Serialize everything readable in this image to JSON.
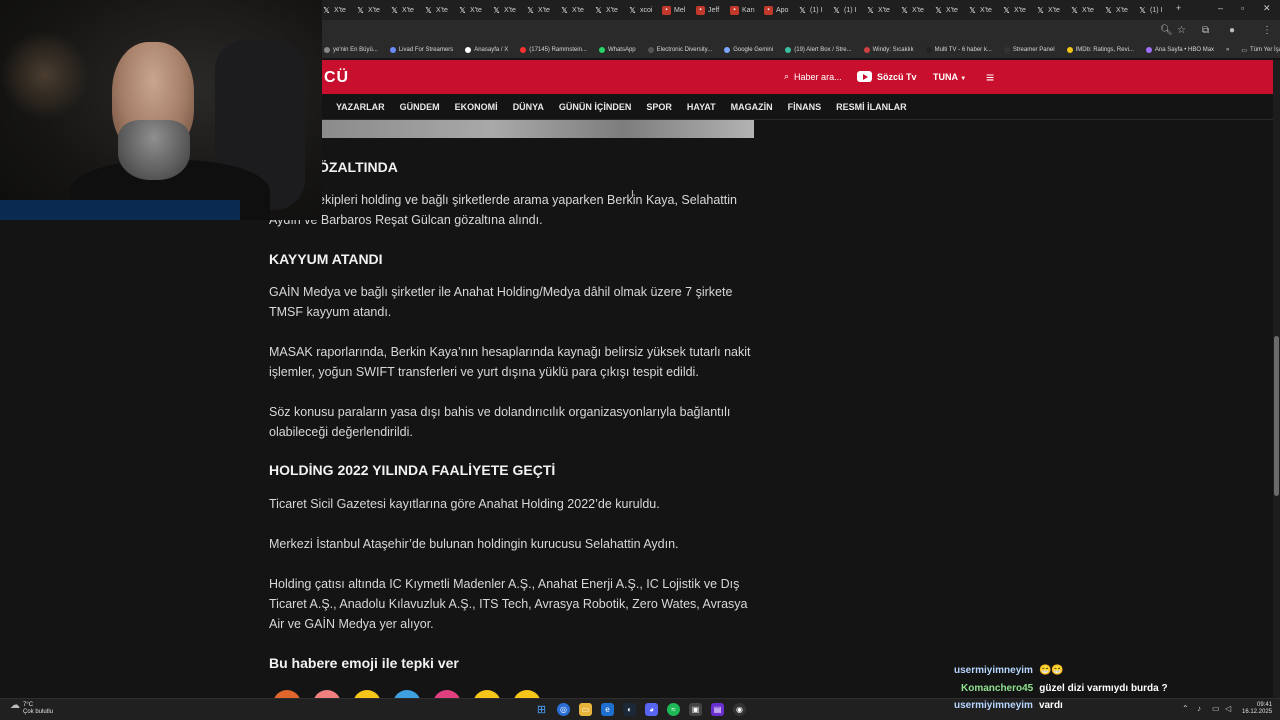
{
  "browser": {
    "tabs": [
      {
        "label": "X'te",
        "icon": "x-icon"
      },
      {
        "label": "X'te",
        "icon": "x-icon"
      },
      {
        "label": "X'te",
        "icon": "x-icon"
      },
      {
        "label": "X'te",
        "icon": "x-icon"
      },
      {
        "label": "X'te",
        "icon": "x-icon"
      },
      {
        "label": "X'te",
        "icon": "x-icon"
      },
      {
        "label": "X'te",
        "icon": "x-icon"
      },
      {
        "label": "X'te",
        "icon": "x-icon"
      },
      {
        "label": "X'te",
        "icon": "x-icon"
      },
      {
        "label": "xcoi",
        "icon": "x-icon"
      },
      {
        "label": "Mel",
        "icon": "red-site-icon"
      },
      {
        "label": "Jeff",
        "icon": "red-site-icon"
      },
      {
        "label": "Karı",
        "icon": "red-site-icon"
      },
      {
        "label": "Apo",
        "icon": "red-site-icon"
      },
      {
        "label": "(1) I",
        "icon": "x-icon"
      },
      {
        "label": "(1) I",
        "icon": "x-icon"
      },
      {
        "label": "X'te",
        "icon": "x-icon"
      },
      {
        "label": "X'te",
        "icon": "x-icon"
      },
      {
        "label": "X'te",
        "icon": "x-icon"
      },
      {
        "label": "X'te",
        "icon": "x-icon"
      },
      {
        "label": "X'te",
        "icon": "x-icon"
      },
      {
        "label": "X'te",
        "icon": "x-icon"
      },
      {
        "label": "X'te",
        "icon": "x-icon"
      },
      {
        "label": "X'te",
        "icon": "x-icon"
      },
      {
        "label": "(1) I",
        "icon": "x-icon"
      }
    ],
    "bookmarks": [
      {
        "label": "ye'nin En Büyü...",
        "color": "#888888"
      },
      {
        "label": "Livad For Streamers",
        "color": "#6b8cff"
      },
      {
        "label": "Anasayfa / X",
        "color": "#ffffff"
      },
      {
        "label": "(17145) Rammstein...",
        "color": "#ff3030"
      },
      {
        "label": "WhatsApp",
        "color": "#25d366"
      },
      {
        "label": "Electronic Diversity...",
        "color": "#555555"
      },
      {
        "label": "Google Gemini",
        "color": "#7aa7ff"
      },
      {
        "label": "(19) Alert Box / Stre...",
        "color": "#39c0a0"
      },
      {
        "label": "Windy: Sıcaklık",
        "color": "#d04040"
      },
      {
        "label": "Multi TV - 6 haber k...",
        "color": "#222222"
      },
      {
        "label": "Streamer Panel",
        "color": "#333333"
      },
      {
        "label": "IMDb: Ratings, Revi...",
        "color": "#f5c518"
      },
      {
        "label": "Ana Sayfa • HBO Max",
        "color": "#a070ff"
      }
    ],
    "bookmarks_more": "»",
    "all_bookmarks": "Tüm Yer İşaretleri"
  },
  "site": {
    "logo": "CÜ",
    "search_placeholder": "Haber ara...",
    "tv_label": "Sözcü Tv",
    "user_label": "TUNA",
    "nav": [
      "YAZARLAR",
      "GÜNDEM",
      "EKONOMİ",
      "DÜNYA",
      "GÜNÜN İÇİNDEN",
      "SPOR",
      "HAYAT",
      "MAGAZİN",
      "FİNANS",
      "RESMİ İLANLAR"
    ]
  },
  "article": {
    "h_gozaltinda": "ÖZALTINDA",
    "p1_line1": "ekipleri holding ve bağlı şirketlerde arama yaparken Berkin Kaya, Selahattin",
    "p1_line2": "Aydın ve Barbaros Reşat Gülcan gözaltına alındı.",
    "h_kayyum": "KAYYUM ATANDI",
    "p2": "GAİN Medya ve bağlı şirketler ile Anahat Holding/Medya dâhil olmak üzere 7 şirkete TMSF kayyum atandı.",
    "p3": "MASAK raporlarında, Berkin Kaya’nın hesaplarında kaynağı belirsiz yüksek tutarlı nakit işlemler, yoğun SWIFT transferleri ve yurt dışına yüklü para çıkışı tespit edildi.",
    "p4": "Söz konusu paraların yasa dışı bahis ve dolandırıcılık organizasyonlarıyla bağlantılı olabileceği değerlendirildi.",
    "h_holding": "HOLDİNG 2022 YILINDA FAALİYETE GEÇTİ",
    "p5": "Ticaret Sicil Gazetesi kayıtlarına göre Anahat Holding 2022’de kuruldu.",
    "p6": "Merkezi İstanbul Ataşehir’de bulunan holdingin kurucusu Selahattin Aydın.",
    "p7": "Holding çatısı altında IC Kıymetli Madenler A.Ş., Anahat Enerji A.Ş., IC Lojistik ve Dış Ticaret A.Ş., Anadolu Kılavuzluk A.Ş., ITS Tech, Avrasya Robotik, Zero Wates, Avrasya Air ve GAİN Medya yer alıyor.",
    "h_emoji": "Bu habere emoji ile tepki ver",
    "emoji_colors": [
      "#e0662e",
      "#f08080",
      "#f5c518",
      "#3fa0e0",
      "#e04080",
      "#f5c518",
      "#f5c518"
    ]
  },
  "chat": [
    {
      "user": "usermiyimneyim",
      "msg": "😁😁"
    },
    {
      "user": "Komanchero45",
      "msg": "güzel dizi varmıydı burda ?"
    },
    {
      "user": "usermiyimneyim",
      "msg": "vardı"
    }
  ],
  "taskbar": {
    "temp": "7°C",
    "weather": "Çok bulutlu",
    "time": "09:41",
    "date": "16.12.2025"
  }
}
